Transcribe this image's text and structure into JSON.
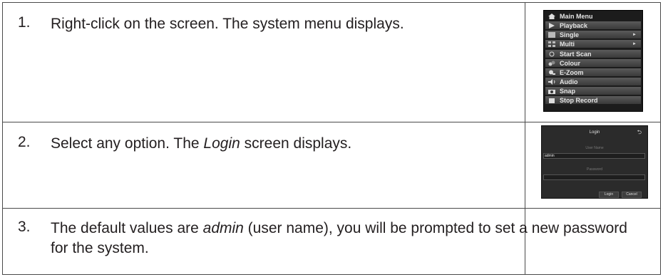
{
  "steps": [
    {
      "number": "1.",
      "text": "Right-click on the screen. The system menu displays."
    },
    {
      "number": "2.",
      "text_before": "Select any option. The ",
      "text_em": "Login",
      "text_after": " screen displays."
    },
    {
      "number": "3.",
      "text_before": "The default values are ",
      "text_em": "admin",
      "text_after": " (user name), you will be prompted to set a new password for the system."
    }
  ],
  "context_menu": {
    "items": [
      {
        "label": "Main Menu",
        "icon": "home-icon"
      },
      {
        "label": "Playback",
        "icon": "play-icon"
      },
      {
        "label": "Single",
        "icon": "single-view-icon",
        "has_submenu": true
      },
      {
        "label": "Multi",
        "icon": "multi-view-icon",
        "has_submenu": true
      },
      {
        "label": "Start Scan",
        "icon": "scan-icon"
      },
      {
        "label": "Colour",
        "icon": "colour-icon"
      },
      {
        "label": "E-Zoom",
        "icon": "zoom-icon"
      },
      {
        "label": "Audio",
        "icon": "audio-icon"
      },
      {
        "label": "Snap",
        "icon": "camera-icon"
      },
      {
        "label": "Stop Record",
        "icon": "record-icon"
      }
    ]
  },
  "login_screen": {
    "title": "Login",
    "user_name_label": "User Name",
    "user_name_value": "admin",
    "password_label": "Password",
    "password_value": "",
    "login_button": "Login",
    "cancel_button": "Cancel"
  }
}
